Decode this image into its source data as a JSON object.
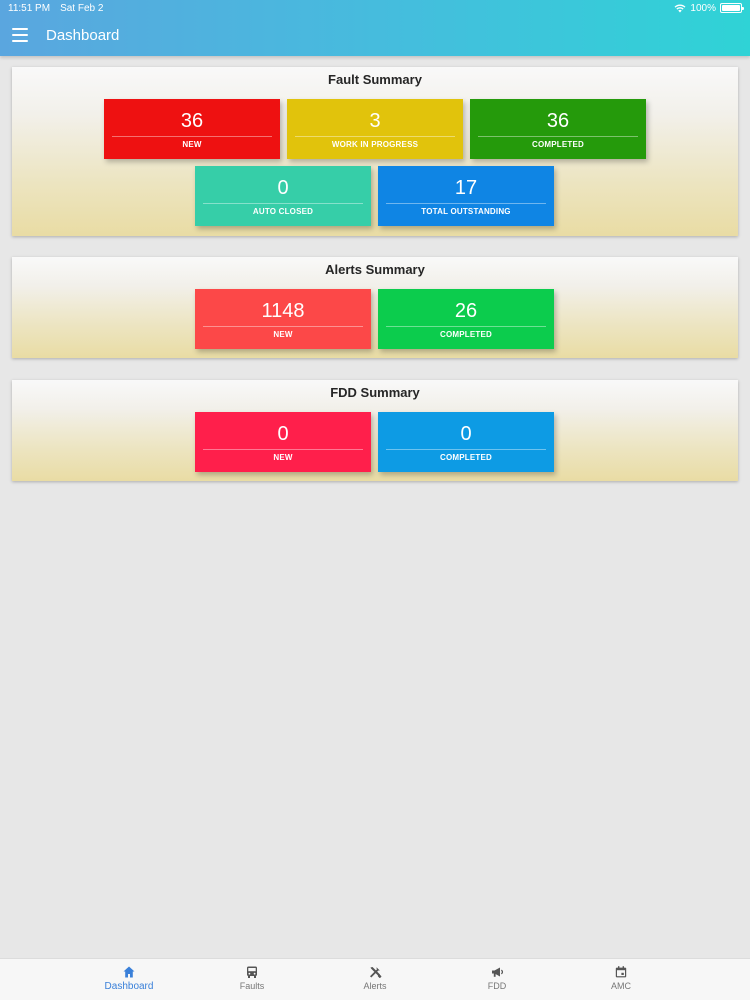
{
  "status_bar": {
    "time": "11:51 PM",
    "date": "Sat Feb 2",
    "battery": "100%"
  },
  "header": {
    "title": "Dashboard",
    "menu_icon": "hamburger-menu-icon"
  },
  "fault_summary": {
    "title": "Fault Summary",
    "tiles": [
      {
        "value": "36",
        "label": "NEW",
        "color": "#ee1111"
      },
      {
        "value": "3",
        "label": "WORK IN PROGRESS",
        "color": "#e1c30c"
      },
      {
        "value": "36",
        "label": "COMPLETED",
        "color": "#259a0b"
      },
      {
        "value": "0",
        "label": "AUTO CLOSED",
        "color": "#36cea8"
      },
      {
        "value": "17",
        "label": "TOTAL OUTSTANDING",
        "color": "#0f85e4"
      }
    ]
  },
  "alerts_summary": {
    "title": "Alerts Summary",
    "tiles": [
      {
        "value": "1148",
        "label": "NEW",
        "color": "#fc4848"
      },
      {
        "value": "26",
        "label": "COMPLETED",
        "color": "#0ccc4d"
      }
    ]
  },
  "fdd_summary": {
    "title": "FDD Summary",
    "tiles": [
      {
        "value": "0",
        "label": "NEW",
        "color": "#ff1f4b"
      },
      {
        "value": "0",
        "label": "COMPLETED",
        "color": "#0d9be4"
      }
    ]
  },
  "bottom_nav": {
    "active_color": "#3a80d9",
    "items": [
      {
        "label": "Dashboard",
        "icon": "home-icon"
      },
      {
        "label": "Faults",
        "icon": "bus-icon"
      },
      {
        "label": "Alerts",
        "icon": "tools-icon"
      },
      {
        "label": "FDD",
        "icon": "megaphone-icon"
      },
      {
        "label": "AMC",
        "icon": "calendar-icon"
      }
    ]
  }
}
